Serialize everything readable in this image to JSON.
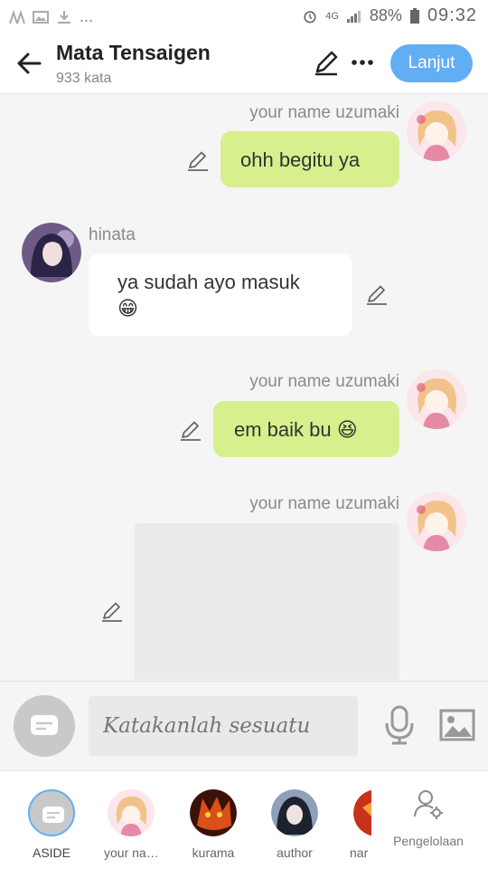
{
  "status": {
    "network": "4G",
    "battery": "88%",
    "time": "09:32",
    "dots": "..."
  },
  "header": {
    "title": "Mata Tensaigen",
    "subtitle": "933 kata",
    "next_label": "Lanjut"
  },
  "messages": [
    {
      "side": "right",
      "name": "your name uzumaki",
      "text": "ohh begitu ya"
    },
    {
      "side": "left",
      "name": "hinata",
      "text_line1": "ya sudah ayo masuk",
      "emoji": "😁"
    },
    {
      "side": "right",
      "name": "your name uzumaki",
      "text": "em baik bu",
      "emoji": "😆"
    },
    {
      "side": "right",
      "name": "your name uzumaki",
      "image": true
    }
  ],
  "input": {
    "placeholder": "Katakanlah sesuatu"
  },
  "characters": [
    {
      "label": "ASIDE"
    },
    {
      "label": "your na…"
    },
    {
      "label": "kurama"
    },
    {
      "label": "author"
    },
    {
      "label": "nar"
    }
  ],
  "manage_label": "Pengelolaan",
  "colors": {
    "accent": "#62aef5",
    "bubble_right": "#d7f08d",
    "bubble_left": "#ffffff"
  }
}
